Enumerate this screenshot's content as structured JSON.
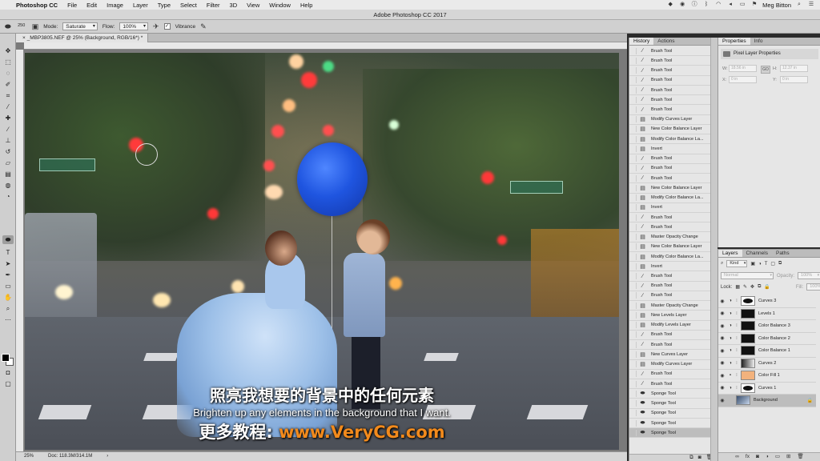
{
  "menubar": {
    "app_name": "Photoshop CC",
    "items": [
      "File",
      "Edit",
      "Image",
      "Layer",
      "Type",
      "Select",
      "Filter",
      "3D",
      "View",
      "Window",
      "Help"
    ],
    "user": "Meg Bitton"
  },
  "window_title": "Adobe Photoshop CC 2017",
  "options": {
    "brush_size": "250",
    "mode_label": "Mode:",
    "mode_value": "Saturate",
    "flow_label": "Flow:",
    "flow_value": "100%",
    "vibrance_label": "Vibrance"
  },
  "document": {
    "tab_title": "_MBP3805.NEF @ 25% (Background, RGB/16*) *",
    "zoom": "25%",
    "doc_size": "Doc: 118.3M/314.1M"
  },
  "subtitles": {
    "chinese": "照亮我想要的背景中的任何元素",
    "english": "Brighten up any elements in the background that I want.",
    "watermark_prefix": "更多教程:",
    "watermark_url": "www.VeryCG.com"
  },
  "history_panel": {
    "tabs": [
      "History",
      "Actions"
    ],
    "items": [
      "Brush Tool",
      "Brush Tool",
      "Brush Tool",
      "Brush Tool",
      "Brush Tool",
      "Brush Tool",
      "Brush Tool",
      "Modify Curves Layer",
      "New Color Balance Layer",
      "Modify Color Balance La...",
      "Invert",
      "Brush Tool",
      "Brush Tool",
      "Brush Tool",
      "New Color Balance Layer",
      "Modify Color Balance La...",
      "Invert",
      "Brush Tool",
      "Brush Tool",
      "Master Opacity Change",
      "New Color Balance Layer",
      "Modify Color Balance La...",
      "Invert",
      "Brush Tool",
      "Brush Tool",
      "Brush Tool",
      "Master Opacity Change",
      "New Levels Layer",
      "Modify Levels Layer",
      "Brush Tool",
      "Brush Tool",
      "New Curves Layer",
      "Modify Curves Layer",
      "Brush Tool",
      "Brush Tool",
      "Sponge Tool",
      "Sponge Tool",
      "Sponge Tool",
      "Sponge Tool",
      "Sponge Tool"
    ],
    "active_index": 39
  },
  "properties_panel": {
    "tabs": [
      "Properties",
      "Info"
    ],
    "header": "Pixel Layer Properties",
    "w_label": "W:",
    "w_value": "18.56 in",
    "h_label": "H:",
    "h_value": "12.37 in",
    "x_label": "X:",
    "x_value": "0 in",
    "y_label": "Y:",
    "y_value": "0 in",
    "link_label": "GO"
  },
  "layers_panel": {
    "tabs": [
      "Layers",
      "Channels",
      "Paths"
    ],
    "filter_value": "Kind",
    "blend_mode": "Normal",
    "opacity_label": "Opacity:",
    "opacity_value": "100%",
    "lock_label": "Lock:",
    "fill_label": "Fill:",
    "fill_value": "100%",
    "layers": [
      {
        "name": "Curves 3",
        "thumb": "curve"
      },
      {
        "name": "Levels 1",
        "thumb": "dark"
      },
      {
        "name": "Color Balance 3",
        "thumb": "dark"
      },
      {
        "name": "Color Balance 2",
        "thumb": "dark"
      },
      {
        "name": "Color Balance 1",
        "thumb": "dark"
      },
      {
        "name": "Curves 2",
        "thumb": "grey"
      },
      {
        "name": "Color Fill 1",
        "thumb": "fill"
      },
      {
        "name": "Curves 1",
        "thumb": "curve"
      },
      {
        "name": "Background",
        "thumb": "photo"
      }
    ],
    "active_index": 8
  },
  "colors": {
    "panel_bg": "#e6e6e6",
    "watermark_url": "#f28a1c",
    "balloon": "#1f55e0"
  }
}
